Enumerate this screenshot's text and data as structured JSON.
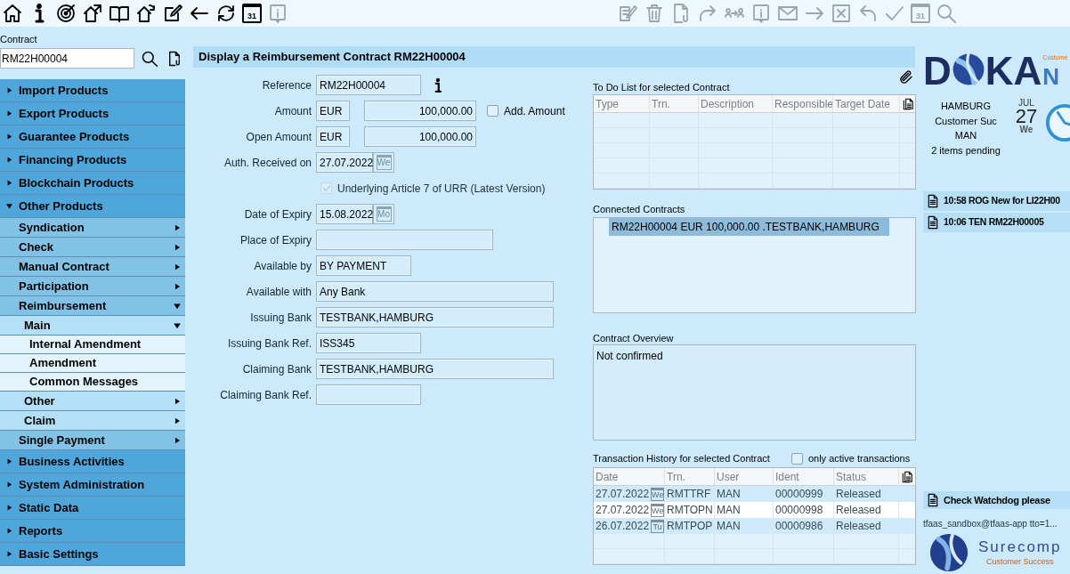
{
  "toolbar": [
    {
      "kind": "home",
      "disabled": false
    },
    {
      "kind": "info",
      "disabled": false
    },
    {
      "kind": "target",
      "disabled": false
    },
    {
      "kind": "house-arrow",
      "disabled": false
    },
    {
      "kind": "book",
      "disabled": false
    },
    {
      "kind": "house-refresh",
      "disabled": false
    },
    {
      "kind": "edit",
      "disabled": false
    },
    {
      "kind": "arrow-left",
      "disabled": false
    },
    {
      "kind": "refresh",
      "disabled": false
    },
    {
      "kind": "calendar",
      "label": "31",
      "disabled": false
    },
    {
      "kind": "info-box",
      "disabled": true
    },
    {
      "kind": "gap"
    },
    {
      "kind": "note-edit",
      "disabled": true
    },
    {
      "kind": "trash",
      "disabled": true
    },
    {
      "kind": "doc-clip",
      "disabled": true
    },
    {
      "kind": "redo",
      "disabled": true
    },
    {
      "kind": "persons",
      "disabled": true
    },
    {
      "kind": "info-box",
      "disabled": true
    },
    {
      "kind": "mail",
      "disabled": true
    },
    {
      "kind": "arrow-right",
      "disabled": true
    },
    {
      "kind": "x-box",
      "disabled": true
    },
    {
      "kind": "undo",
      "disabled": true
    },
    {
      "kind": "check",
      "disabled": true
    },
    {
      "kind": "calendar",
      "label": "31",
      "disabled": true
    },
    {
      "kind": "search",
      "disabled": true
    }
  ],
  "contract_search": {
    "label": "Contract",
    "value": "RM22H00004"
  },
  "sidebar": [
    {
      "label": "Import Products",
      "expanded": false
    },
    {
      "label": "Export Products",
      "expanded": false
    },
    {
      "label": "Guarantee Products",
      "expanded": false
    },
    {
      "label": "Financing Products",
      "expanded": false
    },
    {
      "label": "Blockchain Products",
      "expanded": false
    },
    {
      "label": "Other Products",
      "expanded": true,
      "children": [
        {
          "label": "Syndication",
          "expanded": false
        },
        {
          "label": "Check",
          "expanded": false
        },
        {
          "label": "Manual Contract",
          "expanded": false
        },
        {
          "label": "Participation",
          "expanded": false
        },
        {
          "label": "Reimbursement",
          "expanded": true,
          "children": [
            {
              "label": "Main",
              "expanded": true,
              "children": [
                {
                  "label": "Internal Amendment"
                },
                {
                  "label": "Amendment"
                },
                {
                  "label": "Common Messages"
                }
              ]
            },
            {
              "label": "Other",
              "expanded": false
            },
            {
              "label": "Claim",
              "expanded": false
            }
          ]
        },
        {
          "label": "Single Payment",
          "expanded": false
        }
      ]
    },
    {
      "label": "Business Activities",
      "expanded": false
    },
    {
      "label": "System Administration",
      "expanded": false
    },
    {
      "label": "Static Data",
      "expanded": false
    },
    {
      "label": "Reports",
      "expanded": false
    },
    {
      "label": "Basic Settings",
      "expanded": false
    }
  ],
  "title": "Display a Reimbursement Contract RM22H00004",
  "form": [
    {
      "kind": "text",
      "label": "Reference",
      "value": "RM22H00004",
      "info": true
    },
    {
      "kind": "amount",
      "label": "Amount",
      "currency": "EUR",
      "value": "100,000.00",
      "checkbox": {
        "label": "Add. Amount",
        "checked": false
      }
    },
    {
      "kind": "amount",
      "label": "Open Amount",
      "currency": "EUR",
      "value": "100,000.00"
    },
    {
      "kind": "date",
      "label": "Auth. Received on",
      "value": "27.07.2022",
      "day": "We"
    },
    {
      "kind": "checkbox",
      "label": "Underlying Article 7 of URR (Latest Version)",
      "checked": true,
      "disabled": true
    },
    {
      "kind": "date",
      "label": "Date of Expiry",
      "value": "15.08.2022",
      "day": "Mo"
    },
    {
      "kind": "text",
      "label": "Place of Expiry"
    },
    {
      "kind": "text",
      "label": "Available by",
      "value": "BY PAYMENT"
    },
    {
      "kind": "text",
      "label": "Available with",
      "value": "Any Bank"
    },
    {
      "kind": "text",
      "label": "Issuing Bank",
      "value": "TESTBANK,HAMBURG"
    },
    {
      "kind": "text",
      "label": "Issuing Bank Ref.",
      "value": "ISS345"
    },
    {
      "kind": "text",
      "label": "Claiming Bank",
      "value": "TESTBANK,HAMBURG"
    },
    {
      "kind": "text",
      "label": "Claiming Bank Ref."
    }
  ],
  "todo": {
    "label": "To Do List for selected Contract",
    "columns": [
      "Type",
      "Trn.",
      "Description",
      "Responsible",
      "Target Date"
    ]
  },
  "connected": {
    "label": "Connected Contracts",
    "items": [
      {
        "text": "RM22H00004 EUR 100,000.00 .TESTBANK,HAMBURG",
        "selected": true
      }
    ]
  },
  "overview": {
    "label": "Contract Overview",
    "value": "Not confirmed"
  },
  "history": {
    "label": "Transaction History for selected Contract",
    "filter": {
      "label": "only active transactions",
      "checked": false
    },
    "columns": [
      "Date",
      "Trn.",
      "User",
      "Ident",
      "Status"
    ],
    "rows": [
      {
        "date": "27.07.2022",
        "day": "We",
        "trn": "RMTTRF",
        "user": "MAN",
        "ident": "00000999",
        "status": "Released",
        "selected": false
      },
      {
        "date": "27.07.2022",
        "day": "We",
        "trn": "RMTOPN",
        "user": "MAN",
        "ident": "00000998",
        "status": "Released",
        "selected": true
      },
      {
        "date": "26.07.2022",
        "day": "Tu",
        "trn": "RMTPOP",
        "user": "MAN",
        "ident": "00000986",
        "status": "Released",
        "selected": false
      }
    ]
  },
  "logo": {
    "first": "D",
    "rest": "KA",
    "suffix": "N",
    "tagline": "Custome"
  },
  "user_info": [
    "HAMBURG",
    "Customer Suc",
    "MAN",
    "2 items pending"
  ],
  "date": {
    "month": "JUL",
    "day": "27",
    "weekday": "We"
  },
  "notifications": [
    "10:58 ROG New for LI22H00",
    "10:06 TEN RM22H00005"
  ],
  "watchdog": "Check Watchdog please",
  "session": "tfaas_sandbox@tfaas-app tto=1...",
  "footer_logo": {
    "name": "Surecomp",
    "tagline": "Customer Success"
  }
}
